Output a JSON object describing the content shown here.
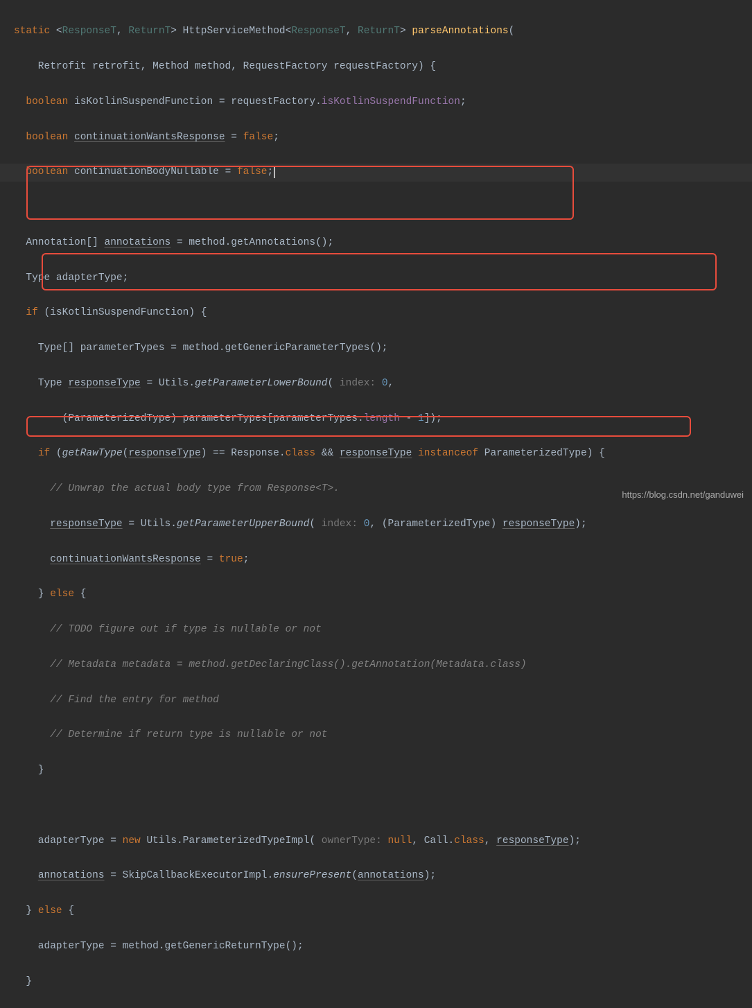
{
  "watermark": "https://blog.csdn.net/ganduwei",
  "code": {
    "l1": {
      "kw_static": "static",
      "angle1": "<",
      "tp1": "ResponseT",
      "comma": ", ",
      "tp2": "ReturnT",
      "angle2": ">",
      "ret": " HttpServiceMethod<",
      "angle3": ">",
      "method": "parseAnnotations",
      "paren": "("
    },
    "l2": {
      "indent": "    Retrofit retrofit, Method method, RequestFactory requestFactory) {"
    },
    "l3": {
      "kw": "boolean",
      "var": " isKotlinSuspendFunction = requestFactory.",
      "field": "isKotlinSuspendFunction",
      "semi": ";"
    },
    "l4": {
      "kw": "boolean",
      "var": "continuationWantsResponse",
      "eq": " = ",
      "val": "false",
      "semi": ";"
    },
    "l5": {
      "kw": "boolean",
      "var": " continuationBodyNullable = ",
      "val": "false",
      "semi": ";"
    },
    "l6": {
      "text": "  Annotation[] ",
      "u": "annotations",
      "rest": " = method.getAnnotations();"
    },
    "l7": {
      "text": "  Type adapterType;"
    },
    "l8": {
      "kw": "if",
      "text": " (isKotlinSuspendFunction) {"
    },
    "l9": {
      "text": "    Type[] parameterTypes = method.getGenericParameterTypes();"
    },
    "l10": {
      "pre": "    Type ",
      "u": "responseType",
      "mid": " = Utils.",
      "ital": "getParameterLowerBound",
      "paren": "(",
      "hint": " index: ",
      "num": "0",
      "comma": ","
    },
    "l11": {
      "pre": "        (ParameterizedType) parameterTypes[parameterTypes.",
      "field": "length",
      "mid": " - ",
      "num": "1",
      "end": "]);"
    },
    "l12": {
      "kw1": "if",
      "pre": " (",
      "ital": "getRawType",
      "p1": "(",
      "u1": "responseType",
      "p2": ") == Response.",
      "kw2": "class",
      "amp": " && ",
      "u2": "responseType",
      "kw3": " instanceof ",
      "rest": "ParameterizedType) {"
    },
    "l13": {
      "comment": "      // Unwrap the actual body type from Response<T>."
    },
    "l14": {
      "u1": "responseType",
      "mid": " = Utils.",
      "ital": "getParameterUpperBound",
      "p1": "(",
      "hint": " index: ",
      "num": "0",
      "mid2": ", (ParameterizedType) ",
      "u2": "responseType",
      "end": ");"
    },
    "l15": {
      "u": "continuationWantsResponse",
      "eq": " = ",
      "val": "true",
      "semi": ";"
    },
    "l16": {
      "brace": "    } ",
      "kw": "else",
      "brace2": " {"
    },
    "l17": {
      "comment": "      // TODO figure out if type is nullable or not"
    },
    "l18": {
      "comment": "      // Metadata metadata = method.getDeclaringClass().getAnnotation(Metadata.class)"
    },
    "l19": {
      "comment": "      // Find the entry for method"
    },
    "l20": {
      "comment": "      // Determine if return type is nullable or not"
    },
    "l21": {
      "text": "    }"
    },
    "l22": {
      "pre": "    adapterType = ",
      "kw": "new",
      "mid": " Utils.ParameterizedTypeImpl(",
      "hint": " ownerType: ",
      "val": "null",
      "mid2": ", Call.",
      "kw2": "class",
      "mid3": ", ",
      "u": "responseType",
      "end": ");"
    },
    "l23": {
      "u1": "annotations",
      "mid": " = SkipCallbackExecutorImpl.",
      "ital": "ensurePresent",
      "p1": "(",
      "u2": "annotations",
      "end": ");"
    },
    "l24": {
      "brace": "  } ",
      "kw": "else",
      "brace2": " {"
    },
    "l25": {
      "text": "    adapterType = method.getGenericReturnType();"
    },
    "l26": {
      "text": "  }"
    }
  }
}
